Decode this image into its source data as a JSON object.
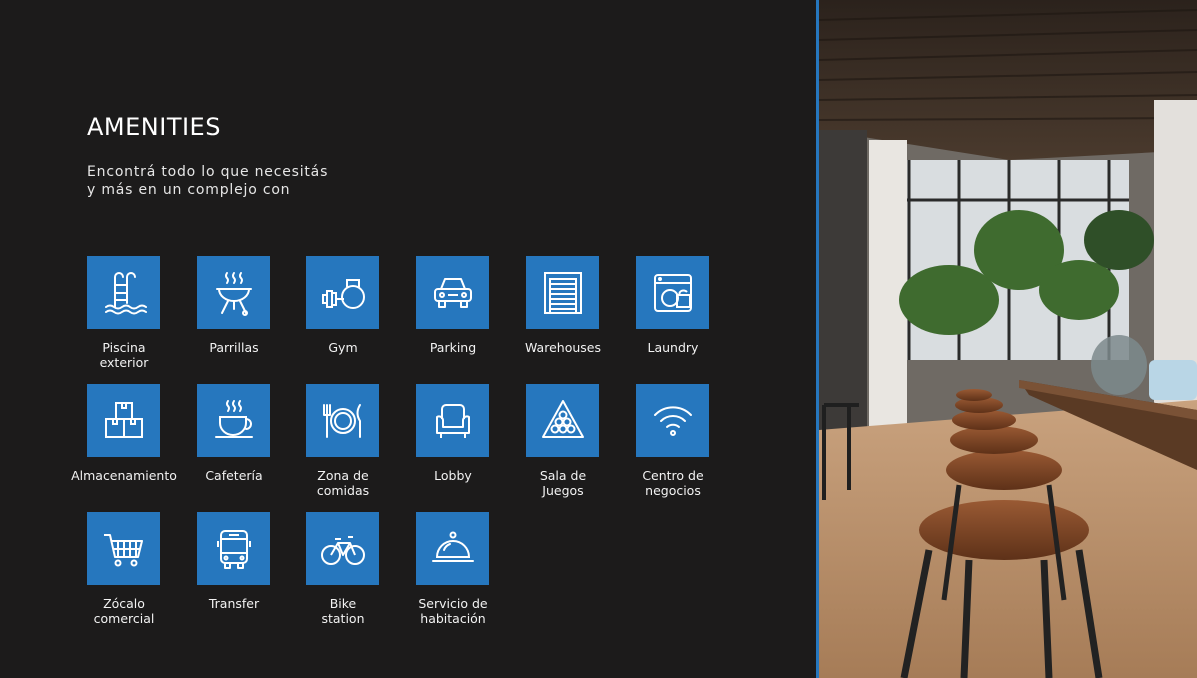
{
  "header": {
    "title": "AMENITIES",
    "subtitle_line1": "Encontrá todo lo que necesitás",
    "subtitle_line2": "y más en un complejo con"
  },
  "amenities": [
    {
      "label": "Piscina\nexterior",
      "icon": "pool-ladder-icon"
    },
    {
      "label": "Parrillas",
      "icon": "grill-icon"
    },
    {
      "label": "Gym",
      "icon": "dumbbell-kettlebell-icon"
    },
    {
      "label": "Parking",
      "icon": "car-icon"
    },
    {
      "label": "Warehouses",
      "icon": "warehouse-door-icon"
    },
    {
      "label": "Laundry",
      "icon": "washing-machine-icon"
    },
    {
      "label": "Almacenamiento",
      "icon": "boxes-icon"
    },
    {
      "label": "Cafetería",
      "icon": "coffee-cup-icon"
    },
    {
      "label": "Zona de\ncomidas",
      "icon": "plate-cutlery-icon"
    },
    {
      "label": "Lobby",
      "icon": "armchair-icon"
    },
    {
      "label": "Sala de\nJuegos",
      "icon": "billiard-triangle-icon"
    },
    {
      "label": "Centro de\nnegocios",
      "icon": "wifi-icon"
    },
    {
      "label": "Zócalo\ncomercial",
      "icon": "shopping-cart-icon"
    },
    {
      "label": "Transfer",
      "icon": "bus-icon"
    },
    {
      "label": "Bike\nstation",
      "icon": "bicycle-icon"
    },
    {
      "label": "Servicio de\nhabitación",
      "icon": "room-service-cloche-icon"
    }
  ],
  "colors": {
    "background": "#1c1b1b",
    "accent": "#2677be",
    "text": "#ffffff"
  }
}
